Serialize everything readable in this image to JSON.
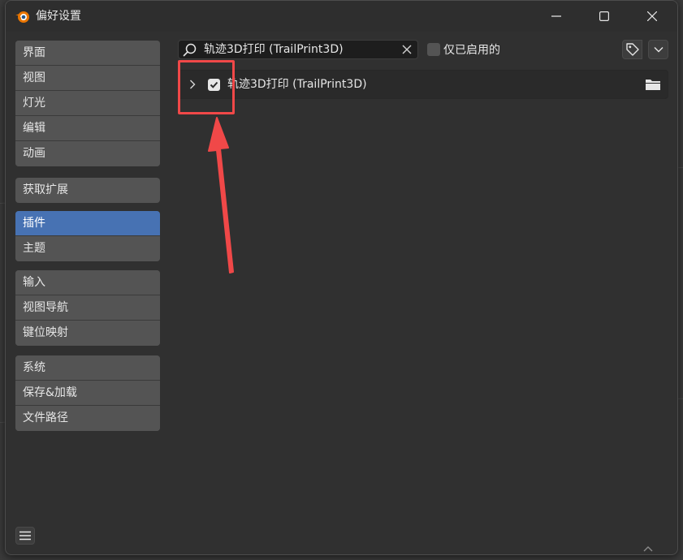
{
  "window": {
    "title": "偏好设置"
  },
  "sidebar": {
    "groups": [
      {
        "items": [
          {
            "label": "界面"
          },
          {
            "label": "视图"
          },
          {
            "label": "灯光"
          },
          {
            "label": "编辑"
          },
          {
            "label": "动画"
          }
        ]
      },
      {
        "items": [
          {
            "label": "获取扩展"
          }
        ]
      },
      {
        "items": [
          {
            "label": "插件",
            "active": true
          },
          {
            "label": "主题"
          }
        ]
      },
      {
        "items": [
          {
            "label": "输入"
          },
          {
            "label": "视图导航"
          },
          {
            "label": "键位映射"
          }
        ]
      },
      {
        "items": [
          {
            "label": "系统"
          },
          {
            "label": "保存&加载"
          },
          {
            "label": "文件路径"
          }
        ]
      }
    ]
  },
  "search": {
    "value": "轨迹3D打印 (TrailPrint3D)"
  },
  "filters": {
    "enabled_only_label": "仅已启用的",
    "enabled_only_checked": false
  },
  "addons": [
    {
      "label": "轨迹3D打印 (TrailPrint3D)",
      "enabled": true,
      "expanded": false
    }
  ],
  "colors": {
    "accent": "#4772b3",
    "annotation": "#f04848",
    "window_bg": "#303030",
    "item_bg": "#545454"
  },
  "icons": {
    "app": "blender-icon",
    "search": "search-icon",
    "clear": "close-icon",
    "tag": "tag-icon",
    "dropdown": "chevron-down-icon",
    "expand": "chevron-right-icon",
    "folder": "folder-icon",
    "menu": "hamburger-menu-icon"
  }
}
